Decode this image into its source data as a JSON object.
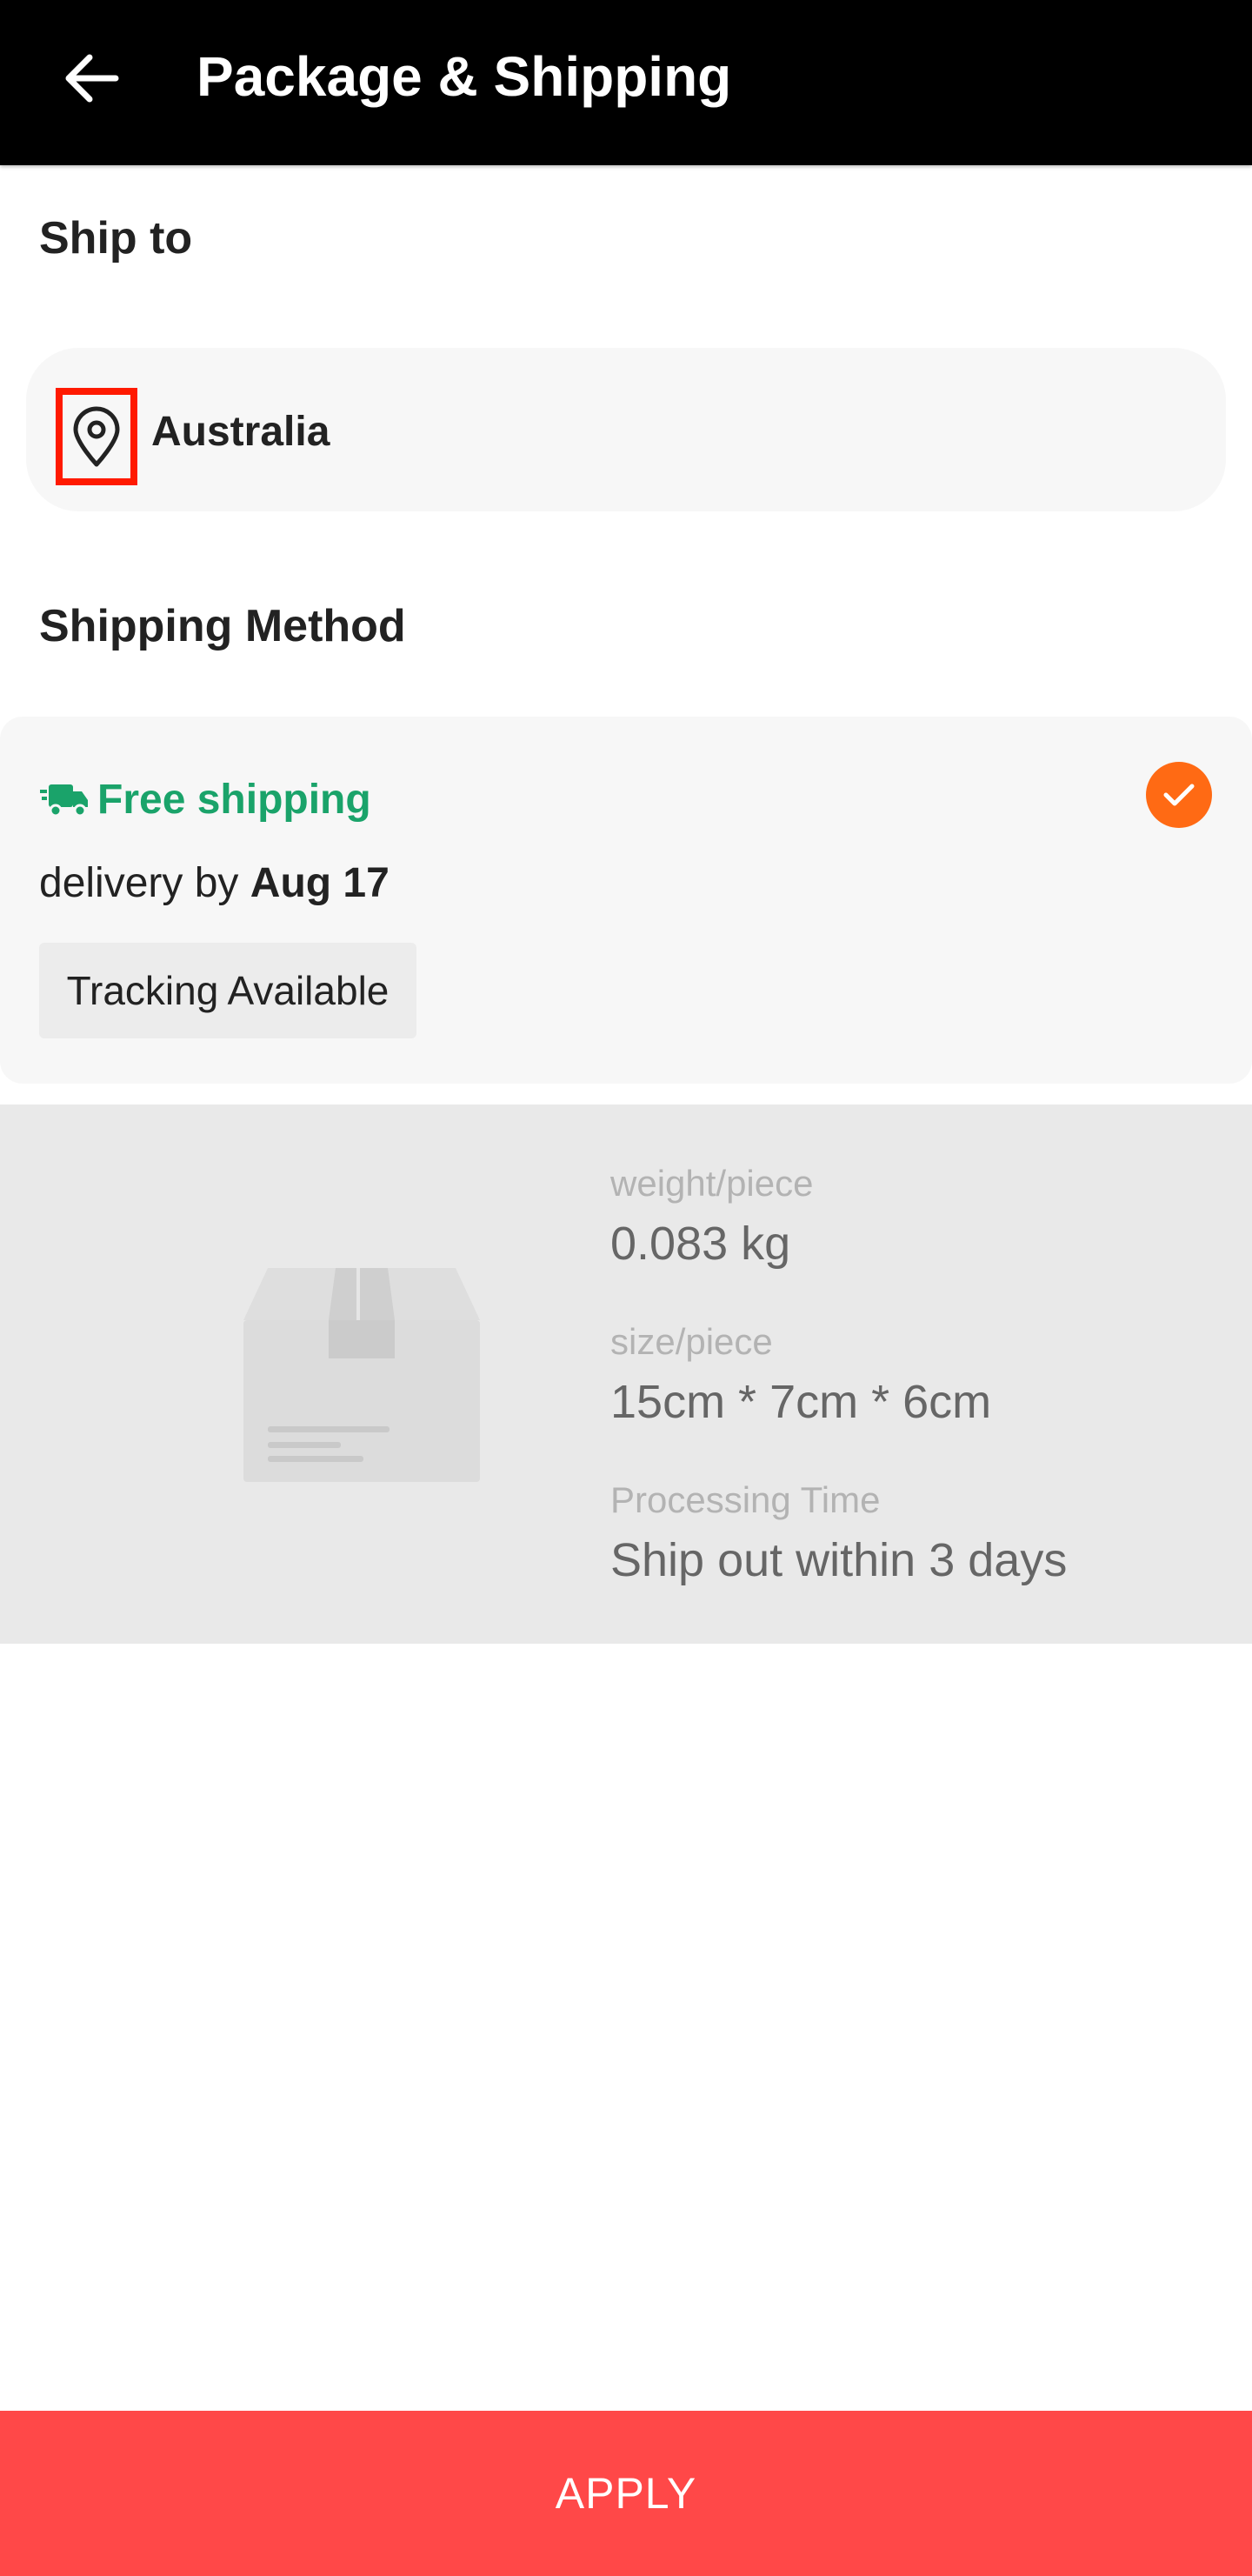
{
  "header": {
    "title": "Package & Shipping"
  },
  "ship_to": {
    "title": "Ship to",
    "country": "Australia"
  },
  "shipping_method": {
    "title": "Shipping Method",
    "option": {
      "label": "Free shipping",
      "delivery_prefix": "delivery by",
      "delivery_date": "Aug 17",
      "tag": "Tracking Available",
      "selected": true
    }
  },
  "package": {
    "weight_label": "weight/piece",
    "weight_value": "0.083 kg",
    "size_label": "size/piece",
    "size_value": "15cm * 7cm * 6cm",
    "processing_label": "Processing Time",
    "processing_value": "Ship out within 3 days"
  },
  "footer": {
    "apply_label": "APPLY"
  },
  "colors": {
    "header_bg": "#000000",
    "free_shipping_green": "#1aa36a",
    "check_orange": "#ff6a14",
    "apply_red": "#ff4848",
    "highlight_red": "#ff1a00"
  },
  "icons": {
    "back": "arrow-left-icon",
    "location": "map-pin-icon",
    "truck": "truck-icon",
    "check": "check-icon",
    "package": "package-box-icon"
  }
}
